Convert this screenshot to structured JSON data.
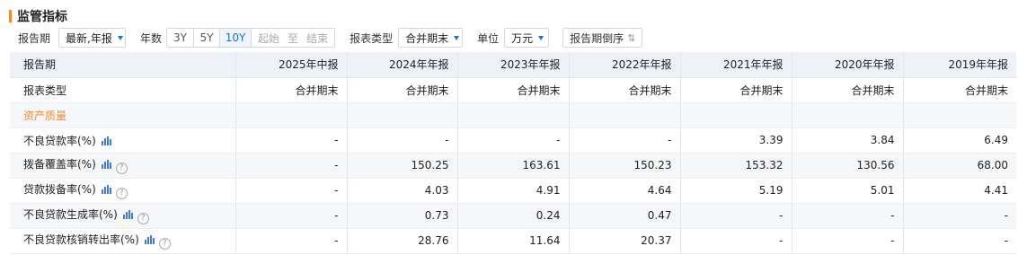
{
  "section_title": "监管指标",
  "toolbar": {
    "period_label": "报告期",
    "period_value": "最新,年报",
    "years_label": "年数",
    "years_options": [
      "3Y",
      "5Y",
      "10Y"
    ],
    "years_selected": "10Y",
    "range_start": "起始",
    "range_sep": "至",
    "range_end": "结束",
    "report_type_label": "报表类型",
    "report_type_value": "合并期末",
    "unit_label": "单位",
    "unit_value": "万元",
    "sort_label": "报告期倒序",
    "sort_icon": "sort-arrows-icon"
  },
  "table": {
    "header_label": "报告期",
    "periods": [
      "2025年中报",
      "2024年年报",
      "2023年年报",
      "2022年年报",
      "2021年年报",
      "2020年年报",
      "2019年年报"
    ],
    "report_type_row": {
      "label": "报表类型",
      "values": [
        "合并期末",
        "合并期末",
        "合并期末",
        "合并期末",
        "合并期末",
        "合并期末",
        "合并期末"
      ]
    },
    "section_label": "资产质量",
    "rows": [
      {
        "label": "不良贷款率(%)",
        "help": false,
        "values": [
          "-",
          "-",
          "-",
          "-",
          "3.39",
          "3.84",
          "6.49"
        ]
      },
      {
        "label": "拨备覆盖率(%)",
        "help": true,
        "values": [
          "-",
          "150.25",
          "163.61",
          "150.23",
          "153.32",
          "130.56",
          "68.00"
        ]
      },
      {
        "label": "贷款拨备率(%)",
        "help": true,
        "values": [
          "-",
          "4.03",
          "4.91",
          "4.64",
          "5.19",
          "5.01",
          "4.41"
        ]
      },
      {
        "label": "不良贷款生成率(%)",
        "help": true,
        "values": [
          "-",
          "0.73",
          "0.24",
          "0.47",
          "-",
          "-",
          "-"
        ]
      },
      {
        "label": "不良贷款核销转出率(%)",
        "help": true,
        "values": [
          "-",
          "28.76",
          "11.64",
          "20.37",
          "-",
          "-",
          "-"
        ]
      }
    ]
  },
  "colors": {
    "accent": "#f08c2f",
    "link": "#1d6fdc",
    "header_bg": "#eef2f8"
  }
}
